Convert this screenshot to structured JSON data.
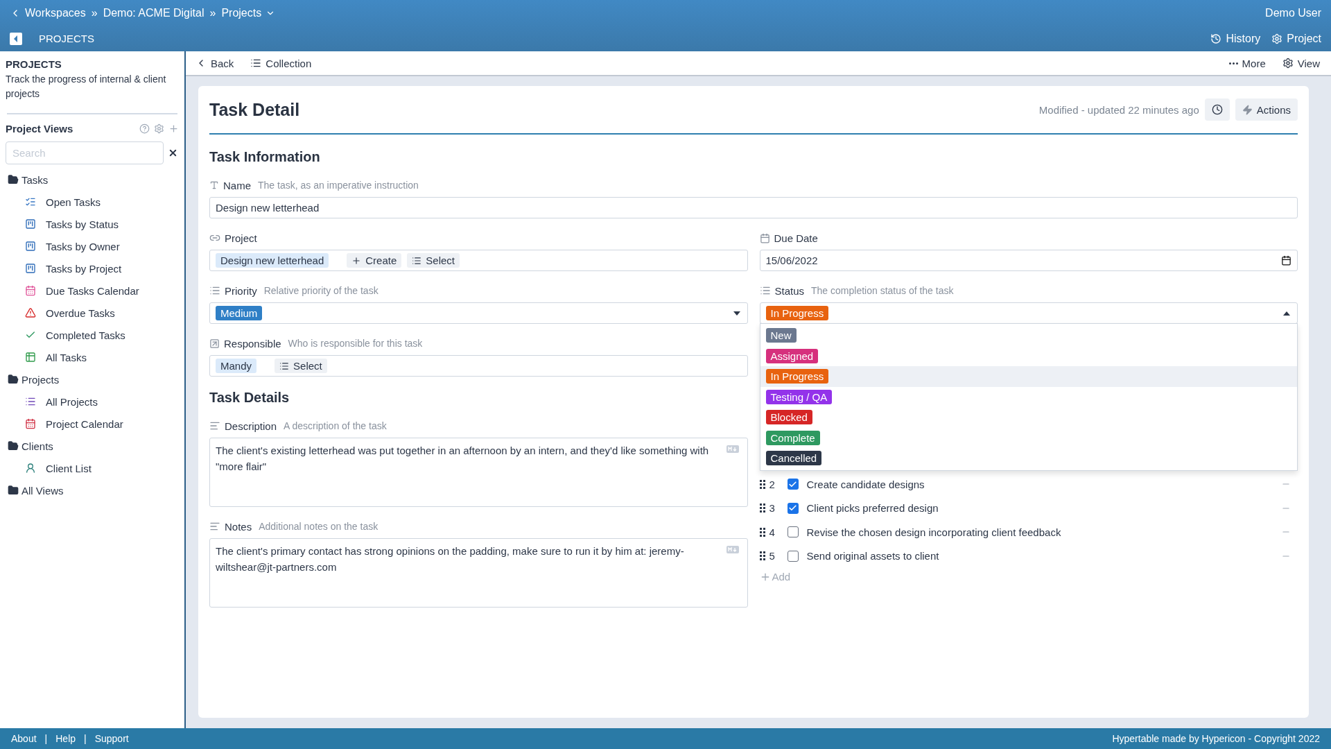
{
  "breadcrumb": {
    "items": [
      "Workspaces",
      "Demo: ACME Digital",
      "Projects"
    ],
    "separator": "»"
  },
  "user": "Demo User",
  "app_bar": {
    "title": "PROJECTS",
    "actions": [
      "History",
      "Project"
    ]
  },
  "sidebar": {
    "heading": "PROJECTS",
    "description": "Track the progress of internal & client projects",
    "views_title": "Project Views",
    "search": {
      "placeholder": "Search"
    },
    "tree": [
      {
        "label": "Tasks",
        "children": [
          "Open Tasks",
          "Tasks by Status",
          "Tasks by Owner",
          "Tasks by Project",
          "Due Tasks Calendar",
          "Overdue Tasks",
          "Completed Tasks",
          "All Tasks"
        ]
      },
      {
        "label": "Projects",
        "children": [
          "All Projects",
          "Project Calendar"
        ]
      },
      {
        "label": "Clients",
        "children": [
          "Client List"
        ]
      },
      {
        "label": "All Views"
      }
    ]
  },
  "toolbar": {
    "left": [
      "Back",
      "Collection"
    ],
    "right": [
      "More",
      "View"
    ]
  },
  "card": {
    "title": "Task Detail",
    "modified": "Modified - updated 22 minutes ago",
    "actions": "Actions"
  },
  "sections": [
    "Task Information",
    "Task Details"
  ],
  "name": {
    "label": "Name",
    "hint": "The task, as an imperative instruction",
    "value": "Design new letterhead"
  },
  "project": {
    "label": "Project",
    "value": "Design new letterhead",
    "buttons": [
      "Create",
      "Select"
    ]
  },
  "due_date": {
    "label": "Due Date",
    "value": "15/06/2022"
  },
  "priority": {
    "label": "Priority",
    "hint": "Relative priority of the task",
    "value": "Medium",
    "color": "#2f7fc6",
    "expanded": false
  },
  "status": {
    "label": "Status",
    "hint": "The completion status of the task",
    "value": "In Progress",
    "color": "#e8620f",
    "expanded": true,
    "options": [
      {
        "label": "New",
        "color": "#6b788f",
        "selected": false
      },
      {
        "label": "Assigned",
        "color": "#d6307d",
        "selected": false
      },
      {
        "label": "In Progress",
        "color": "#e8620f",
        "selected": true
      },
      {
        "label": "Testing / QA",
        "color": "#9333ea",
        "selected": false
      },
      {
        "label": "Blocked",
        "color": "#d62626",
        "selected": false
      },
      {
        "label": "Complete",
        "color": "#2e9960",
        "selected": false
      },
      {
        "label": "Cancelled",
        "color": "#2d3748",
        "selected": false
      }
    ]
  },
  "responsible": {
    "label": "Responsible",
    "hint": "Who is responsible for this task",
    "value": "Mandy",
    "button": "Select"
  },
  "description": {
    "label": "Description",
    "hint": "A description of the task",
    "value": "The client's existing letterhead was put together in an afternoon by an intern, and they'd like something with \"more flair\""
  },
  "notes": {
    "label": "Notes",
    "hint": "Additional notes on the task",
    "value": "The client's primary contact has strong opinions on the padding, make sure to run it by him at: jeremy-wiltshear@jt-partners.com"
  },
  "subtasks": [
    {
      "number": "2",
      "label": "Create candidate designs",
      "checked": true
    },
    {
      "number": "3",
      "label": "Client picks preferred design",
      "checked": true
    },
    {
      "number": "4",
      "label": "Revise the chosen design incorporating client feedback",
      "checked": false
    },
    {
      "number": "5",
      "label": "Send original assets to client",
      "checked": false
    }
  ],
  "add": "Add",
  "footer": {
    "links": [
      "About",
      "Help",
      "Support"
    ],
    "separator": "|",
    "copyright": "Hypertable made by Hypericon - Copyright 2022"
  }
}
